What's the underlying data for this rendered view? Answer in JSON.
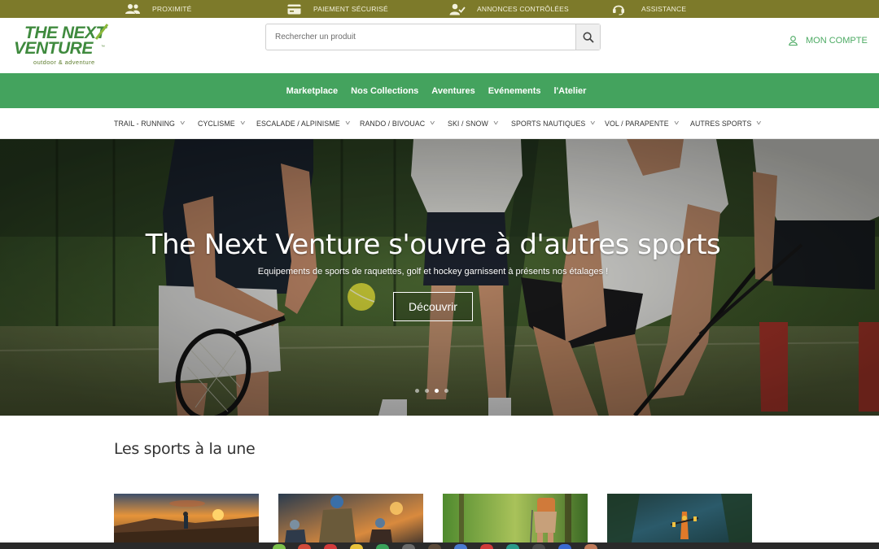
{
  "topbar": {
    "items": [
      {
        "label": "PROXIMITÉ",
        "icon": "users-icon"
      },
      {
        "label": "PAIEMENT SÉCURISÉ",
        "icon": "credit-card-icon"
      },
      {
        "label": "ANNONCES CONTRÔLÉES",
        "icon": "verified-user-icon"
      },
      {
        "label": "ASSISTANCE",
        "icon": "headset-icon"
      }
    ]
  },
  "header": {
    "logo": {
      "line1": "THE NEXT",
      "line2": "VENTURE",
      "tagline": "outdoor & adventure",
      "tm": "™"
    },
    "search": {
      "placeholder": "Rechercher un produit",
      "value": "",
      "button_icon": "search-icon"
    },
    "account": {
      "label": "MON COMPTE",
      "icon": "user-icon"
    }
  },
  "main_nav": {
    "items": [
      "Marketplace",
      "Nos Collections",
      "Aventures",
      "Evénements",
      "l'Atelier"
    ]
  },
  "category_nav": {
    "items": [
      "TRAIL - RUNNING",
      "CYCLISME",
      "ESCALADE / ALPINISME",
      "RANDO / BIVOUAC",
      "SKI / SNOW",
      "SPORTS NAUTIQUES",
      "VOL / PARAPENTE",
      "AUTRES SPORTS"
    ]
  },
  "hero": {
    "title": "The Next Venture s'ouvre à d'autres sports",
    "subtitle": "Equipements de sports de raquettes, golf et hockey garnissent à présents nos étalages !",
    "cta": "Découvrir",
    "slides_count": 4,
    "active_slide": 3
  },
  "featured": {
    "title": "Les sports à la une",
    "cards": [
      {
        "name": "trail-running-card",
        "image": "runner-sunset"
      },
      {
        "name": "cycling-card",
        "image": "cyclists-group"
      },
      {
        "name": "hiking-card",
        "image": "hiker-forest"
      },
      {
        "name": "kayak-card",
        "image": "kayak-river"
      }
    ]
  },
  "colors": {
    "topbar": "#7d7a2a",
    "brand_green": "#44a35e",
    "logo_green": "#3f8a3e",
    "account_green": "#4caa63"
  }
}
